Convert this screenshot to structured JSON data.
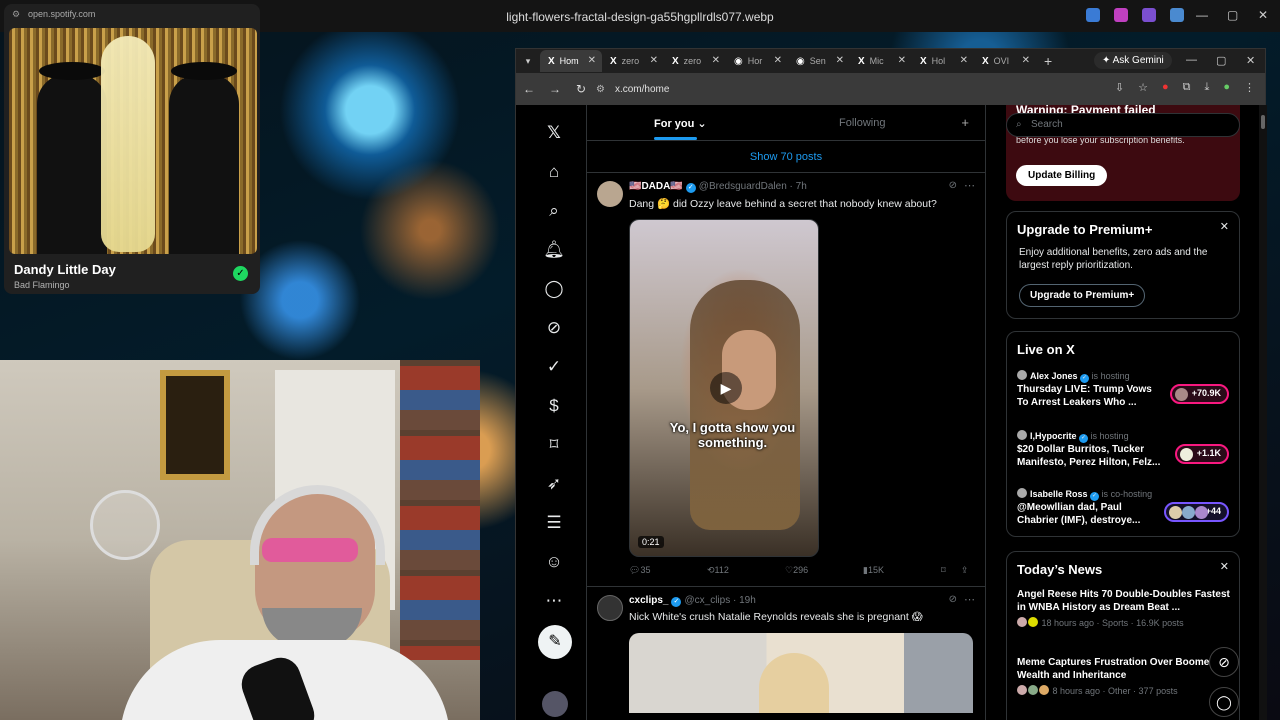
{
  "viewer": {
    "title": "light-flowers-fractal-design-ga55hgpllrdls077.webp"
  },
  "spotify": {
    "url": "open.spotify.com",
    "song": "Dandy Little Day",
    "artist": "Bad Flamingo"
  },
  "browser": {
    "tabs": [
      {
        "label": "Hom",
        "fav": "X"
      },
      {
        "label": "zero",
        "fav": "X"
      },
      {
        "label": "zero",
        "fav": "X"
      },
      {
        "label": "Hor",
        "fav": "◉"
      },
      {
        "label": "Sen",
        "fav": "◉"
      },
      {
        "label": "Mic",
        "fav": "X"
      },
      {
        "label": "Hol",
        "fav": "X"
      },
      {
        "label": "OVI",
        "fav": "X"
      }
    ],
    "gemini": "Ask Gemini",
    "url": "x.com/home"
  },
  "feed": {
    "tab_for_you": "For you",
    "tab_following": "Following",
    "show_posts": "Show 70 posts",
    "tweet1": {
      "name": "🇺🇸DADA🇺🇸",
      "handle": "@BredsguardDalen · 7h",
      "text": "Dang 🤔 did Ozzy leave behind a secret that nobody knew about?",
      "caption": "Yo, I gotta show you something.",
      "duration": "0:21",
      "replies": "35",
      "reposts": "112",
      "likes": "296",
      "views": "15K"
    },
    "tweet2": {
      "name": "cxclips_",
      "handle": "@cx_clips · 19h",
      "text": "Nick White's crush Natalie Reynolds reveals she is pregnant 😱"
    }
  },
  "sidebar": {
    "billing_title": "Warning: Payment failed",
    "billing_sub": "before you lose your subscription benefits.",
    "update_billing": "Update Billing",
    "search_placeholder": "Search",
    "premium_title": "Upgrade to Premium+",
    "premium_desc": "Enjoy additional benefits, zero ads and the largest reply prioritization.",
    "premium_button": "Upgrade to Premium+",
    "live_title": "Live on X",
    "live": [
      {
        "host": "Alex Jones",
        "status": "is hosting",
        "title": "Thursday LIVE: Trump Vows To Arrest Leakers Who ...",
        "count": "+70.9K"
      },
      {
        "host": "I,Hypocrite",
        "status": "is hosting",
        "title": "$20 Dollar Burritos, Tucker Manifesto, Perez Hilton, Felz...",
        "count": "+1.1K"
      },
      {
        "host": "Isabelle Ross",
        "status": "is co-hosting",
        "title": "@Meowllian dad, Paul Chabrier (IMF), destroye...",
        "count": "+44"
      }
    ],
    "news_title": "Today’s News",
    "news": [
      {
        "title": "Angel Reese Hits 70 Double-Doubles Fastest in WNBA History as Dream Beat ...",
        "meta": "18 hours ago · Sports · 16.9K posts"
      },
      {
        "title": "Meme Captures Frustration Over Boomer Wealth and Inheritance",
        "meta": "8 hours ago · Other · 377 posts"
      }
    ]
  }
}
